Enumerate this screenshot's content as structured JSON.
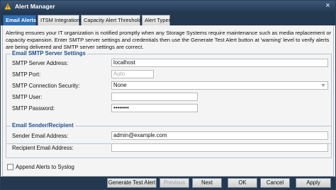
{
  "window": {
    "title": "Alert Manager",
    "app_icon": "warning-triangle-icon",
    "close_icon": "close-icon",
    "close_glyph": "×"
  },
  "tabs": [
    {
      "label": "Email Alerts",
      "active": true
    },
    {
      "label": "ITSM Integrations",
      "active": false
    },
    {
      "label": "Capacity Alert Thresholds",
      "active": false
    },
    {
      "label": "Alert Types",
      "active": false
    }
  ],
  "intro": "Alerting ensures your IT organization is notified promptly when any Storage Systems require maintenance such as media replacement or capacity expansion. Enter SMTP server settings and credentials then use the Generate Test Alert button at 'warning' level to verify alerts are being delivered and SMTP server settings are correct.",
  "smtp": {
    "legend": "Email SMTP Server Settings",
    "server_address_label": "SMTP Server Address:",
    "server_address_value": "localhost",
    "port_label": "SMTP Port:",
    "port_placeholder": "Auto",
    "security_label": "SMTP Connection Security:",
    "security_value": "None",
    "user_label": "SMTP User:",
    "user_value": "",
    "password_label": "SMTP Password:",
    "password_value": "••••••••"
  },
  "sender": {
    "legend": "Email Sender/Recipient",
    "sender_label": "Sender Email Address:",
    "sender_value": "admin@example.com",
    "recipient_label": "Recipient Email Address:",
    "recipient_value": ""
  },
  "syslog": {
    "label": "Append Alerts to Syslog",
    "checked": false
  },
  "footer": {
    "generate_test_alert": "Generate Test Alert",
    "previous": "Previous",
    "next": "Next",
    "ok": "OK",
    "cancel": "Cancel",
    "apply": "Apply"
  },
  "colors": {
    "title_bar": "#243a55",
    "active_tab": "#2f6fb6",
    "legend_text": "#1f4e8c"
  }
}
